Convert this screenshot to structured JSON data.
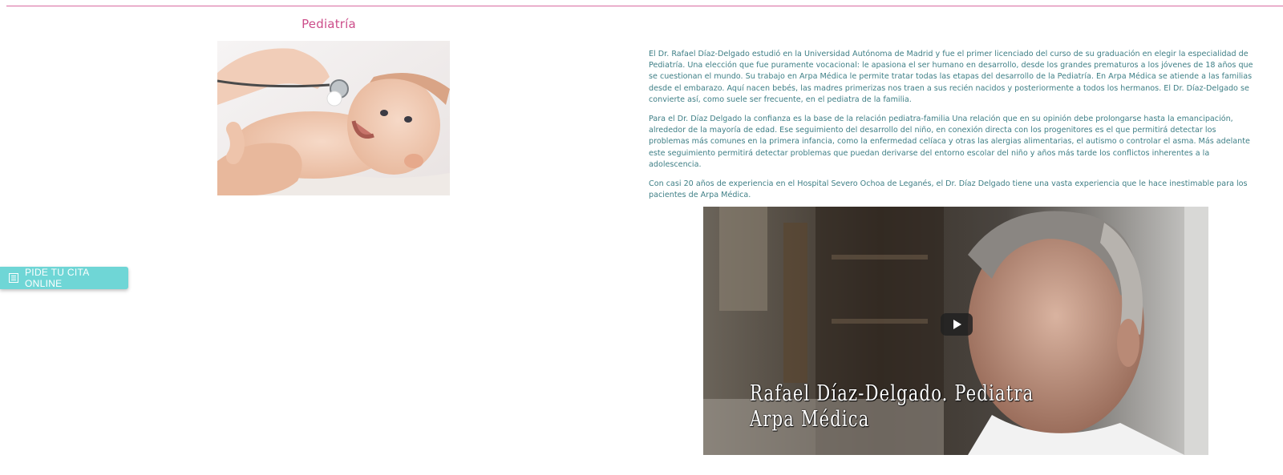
{
  "section": {
    "title": "Pediatría"
  },
  "bio": {
    "paragraphs": [
      "El Dr. Rafael Díaz-Delgado estudió en la Universidad Autónoma de Madrid y fue el primer licenciado del curso de su graduación en elegir la especialidad de Pediatría. Una elección que fue puramente vocacional: le apasiona el ser humano en desarrollo, desde los grandes prematuros a los jóvenes de 18 años que se cuestionan el mundo. Su trabajo en Arpa Médica le permite tratar todas las etapas del desarrollo de la Pediatría. En Arpa Médica se atiende a las familias desde el embarazo. Aquí nacen bebés, las madres primerizas nos traen a sus recién nacidos y posteriormente a todos los hermanos. El Dr. Díaz-Delgado se convierte así, como suele ser frecuente, en el pediatra de la familia.",
      "Para el Dr. Díaz Delgado la confianza es la base de la relación pediatra-familia Una relación que en su opinión debe prolongarse hasta la emancipación, alrededor de la mayoría de edad. Ese seguimiento del desarrollo del niño, en conexión directa con los progenitores es el que permitirá detectar los problemas más comunes en la primera infancia, como la enfermedad celíaca y otras las alergias alimentarias, el autismo o controlar el asma. Más adelante este seguimiento permitirá detectar problemas que puedan derivarse del entorno escolar del niño y años más tarde los conflictos inherentes a la adolescencia.",
      "Con casi 20 años de experiencia en el Hospital Severo Ochoa de Leganés, el Dr. Díaz Delgado tiene una vasta experiencia que le hace inestimable para los pacientes de Arpa Médica."
    ]
  },
  "video": {
    "caption_line1": "Rafael Díaz-Delgado. Pediatra",
    "caption_line2": "Arpa Médica",
    "play_icon": "play-icon"
  },
  "cta": {
    "label": "PIDE TU CITA ONLINE",
    "icon": "list-icon"
  },
  "colors": {
    "accent_pink": "#cc4d8a",
    "text_teal": "#3f7f86",
    "cta_teal": "#6fd6d6"
  }
}
